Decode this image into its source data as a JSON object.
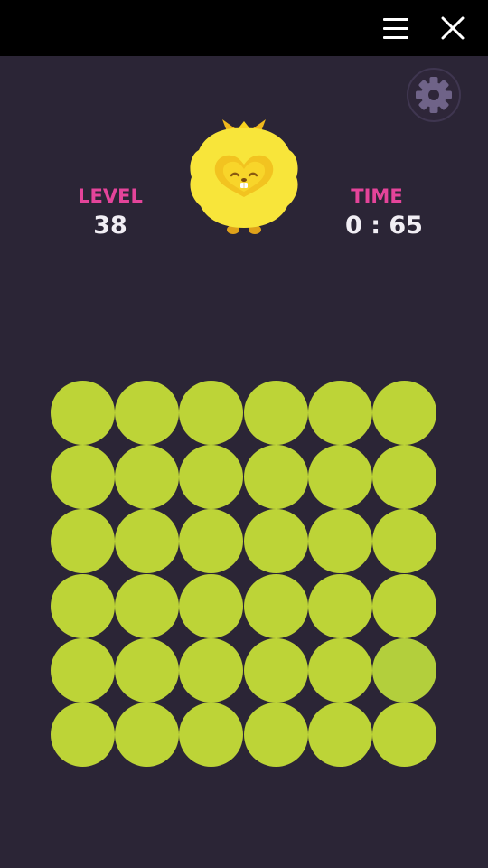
{
  "topbar": {
    "menu_icon": "hamburger-menu-icon",
    "close_icon": "close-icon"
  },
  "hud": {
    "level_label": "LEVEL",
    "level_value": "38",
    "time_label": "TIME",
    "time_value": "0 : 65",
    "settings_icon": "gear-icon",
    "mascot_icon": "yellow-fluffy-creature-icon"
  },
  "colors": {
    "background": "#2b2536",
    "topbar": "#000000",
    "label_pink": "#e4449a",
    "value_white": "#f1eef4",
    "tile": "#bdd437",
    "tile_odd": "#b3cf3c"
  },
  "board": {
    "rows": 6,
    "cols": 6,
    "odd_tile": {
      "row": 5,
      "col": 6
    }
  }
}
